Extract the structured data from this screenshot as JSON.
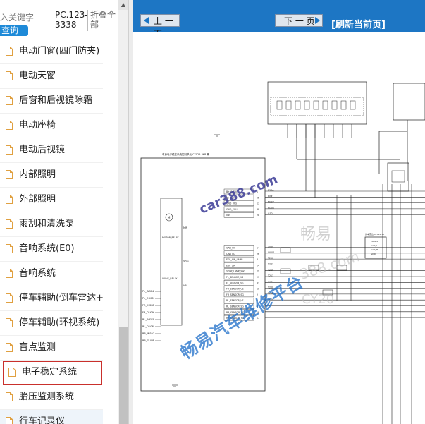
{
  "search": {
    "placeholder": "入关键字",
    "query_label": "查询"
  },
  "header": {
    "pc_label": "PC.123-3338",
    "collapse_label": "折叠全部"
  },
  "menu": {
    "items": [
      {
        "label": "电动门窗(四门防夹)"
      },
      {
        "label": "电动天窗"
      },
      {
        "label": "后窗和后视镜除霜"
      },
      {
        "label": "电动座椅"
      },
      {
        "label": "电动后视镜"
      },
      {
        "label": "内部照明"
      },
      {
        "label": "外部照明"
      },
      {
        "label": "雨刮和清洗泵"
      },
      {
        "label": "音响系统(E0)"
      },
      {
        "label": "音响系统"
      },
      {
        "label": "停车辅助(倒车雷达+倒车"
      },
      {
        "label": "停车辅助(环视系统)"
      },
      {
        "label": "盲点监测"
      },
      {
        "label": "电子稳定系统"
      },
      {
        "label": "胎压监测系统"
      },
      {
        "label": "行车记录仪"
      }
    ],
    "highlighted_index": 13,
    "active_index": 15
  },
  "nav": {
    "prev_label": "上 一 页",
    "next_label": "下 一 页",
    "refresh_label": "[刷新当前页]"
  },
  "diagram": {
    "watermarks": [
      "car388.com",
      "畅易汽车维修平台",
      "畅易",
      "388.com",
      "CY20"
    ],
    "module_title": "车身电子稳定系统控制单元 C7025 36P 黑",
    "left_labels": [
      "PL_INS04",
      "PL_OU06",
      "FR_INS08",
      "FR_OU09",
      "RL_INS05",
      "RL_OU06",
      "RR_INS07",
      "RR_OU08"
    ],
    "module_pins": [
      "B+ (MTR)",
      "B+ (SOL)",
      "GND_VPS",
      "GND_ECU",
      "IGN",
      "CAN_HI",
      "CAN_LO",
      "ESC_SW_LAMP",
      "ESC_SW",
      "STOP_LAMP_SW",
      "FL_SENSOR_VS",
      "FL_SENSOR_SG",
      "FR_SENSOR_VS",
      "FR_SENSOR_SG",
      "RL_SENSOR_VS",
      "RL_SENSOR_SG",
      "RR_SENSOR_VS",
      "RR_SENSOR_SG"
    ],
    "internal_labels": [
      "MOTOR_RELAY",
      "VALVE_RELAY",
      "MR",
      "VRG",
      "VR",
      "M"
    ],
    "pin_numbers": [
      "1",
      "25",
      "13",
      "38",
      "28",
      "14",
      "26",
      "8",
      "24",
      "29",
      "21",
      "33",
      "19",
      "2",
      "6",
      "4",
      "18",
      "17"
    ],
    "wire_labels": [
      "B50A",
      "B041",
      "M707",
      "M705",
      "G101",
      "S060",
      "I2004",
      "T250",
      "T201",
      "T210",
      "T211",
      "T201",
      "T200",
      "T202",
      "T202"
    ],
    "right_module_pins": [
      "POWER",
      "CAN_L",
      "CAN_H",
      "GND"
    ],
    "right_module_title": "倒车雷达 C7026 4P"
  }
}
